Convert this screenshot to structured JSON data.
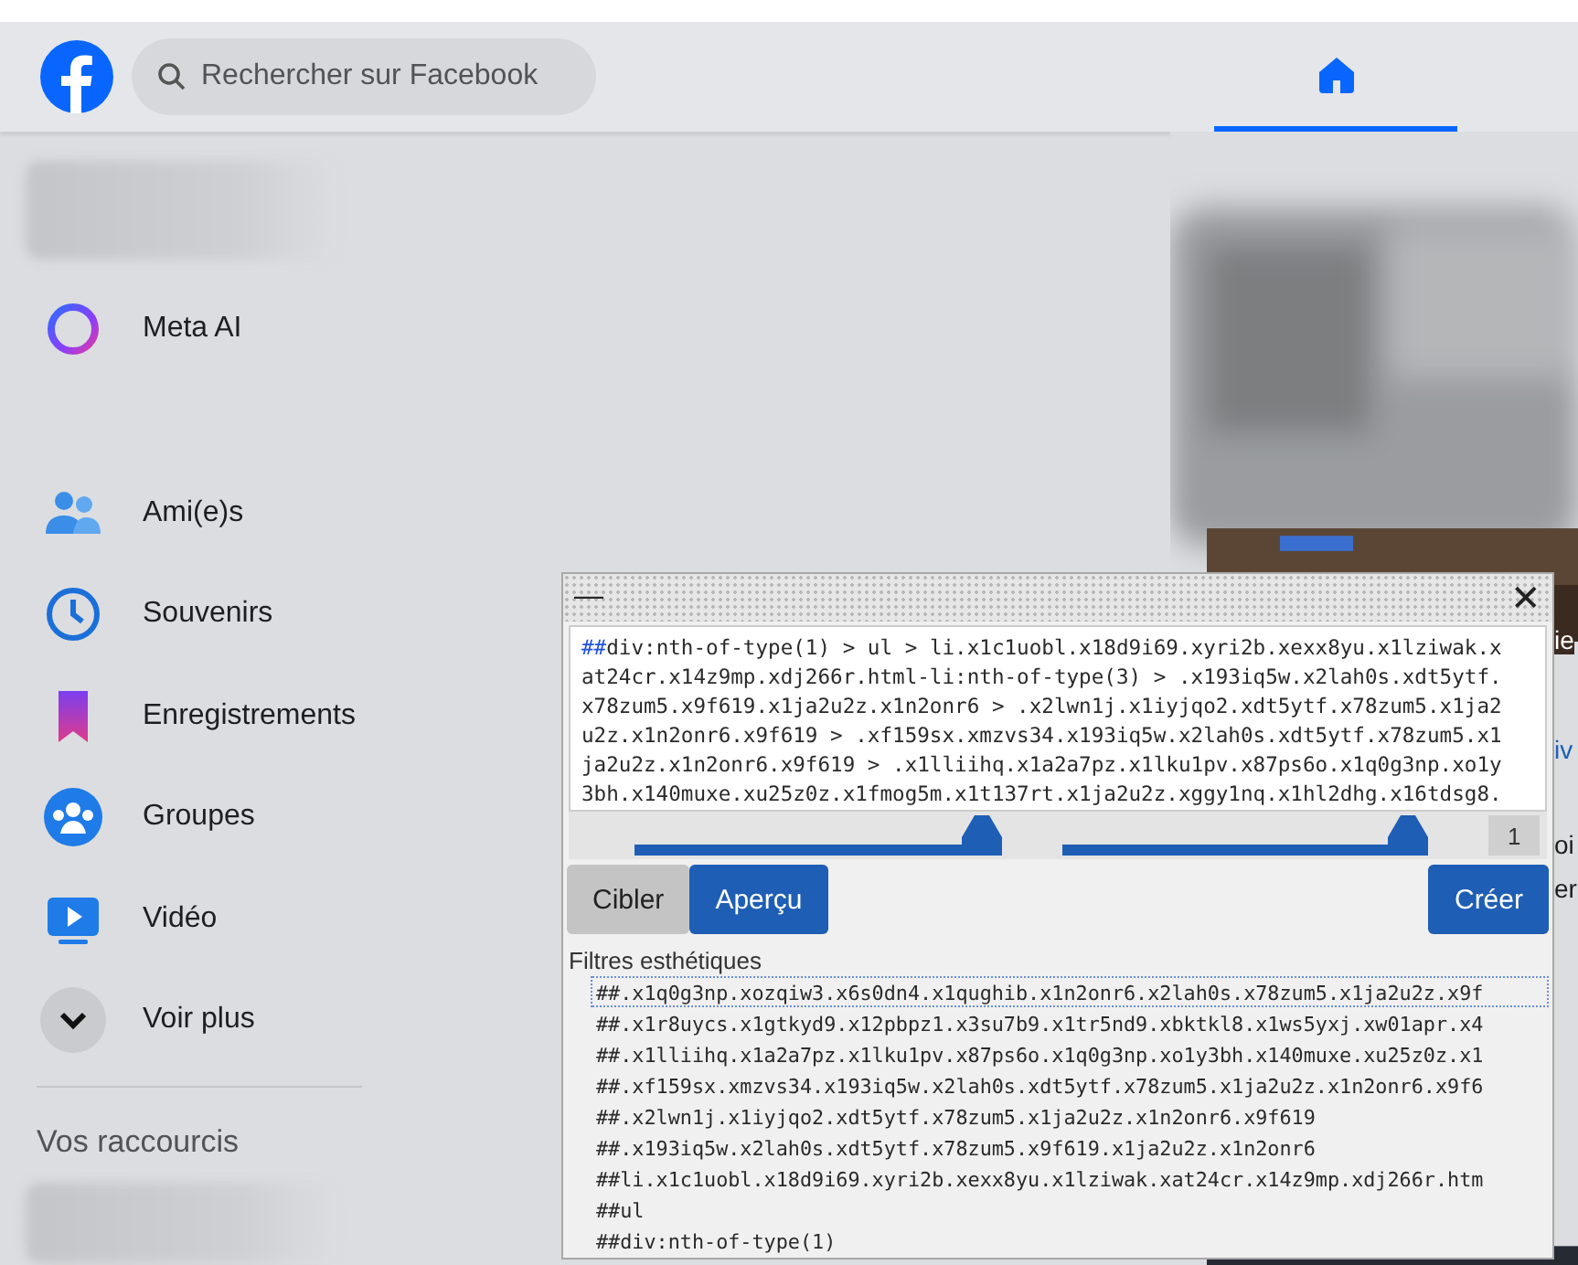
{
  "header": {
    "search": {
      "placeholder": "Rechercher sur Facebook"
    },
    "nav_tabs": [
      {
        "kind": "home",
        "selected": true
      }
    ]
  },
  "sidebar": {
    "items": [
      {
        "kind": "meta-ai",
        "label": "Meta AI"
      },
      {
        "kind": "friends",
        "label": "Ami(e)s"
      },
      {
        "kind": "memories",
        "label": "Souvenirs"
      },
      {
        "kind": "saved",
        "label": "Enregistrements"
      },
      {
        "kind": "groups",
        "label": "Groupes"
      },
      {
        "kind": "video",
        "label": "Vidéo"
      },
      {
        "kind": "more",
        "label": "Voir plus"
      }
    ],
    "shortcuts_title": "Vos raccourcis"
  },
  "feed": {
    "fragments": [
      "ie",
      "iv",
      "oi",
      "er"
    ]
  },
  "filter_dialog": {
    "minimize": "—",
    "close": "✕",
    "selector_lines": [
      "##div:nth-of-type(1) > ul > li.x1c1uobl.x18d9i69.xyri2b.xexx8yu.x1lziwak.x",
      "at24cr.x14z9mp.xdj266r.html-li:nth-of-type(3) > .x193iq5w.x2lah0s.xdt5ytf.",
      "x78zum5.x9f619.x1ja2u2z.x1n2onr6 > .x2lwn1j.x1iyjqo2.xdt5ytf.x78zum5.x1ja2",
      "u2z.x1n2onr6.x9f619 > .xf159sx.xmzvs34.x193iq5w.x2lah0s.xdt5ytf.x78zum5.x1",
      "ja2u2z.x1n2onr6.x9f619 > .x1lliihq.x1a2a7pz.x1lku1pv.x87ps6o.x1q0g3np.xo1y",
      "3bh.x140muxe.xu25z0z.x1fmog5m.x1t137rt.x1ja2u2z.xggy1nq.x1hl2dhg.x16tdsg8."
    ],
    "sliders": [
      {
        "level": 0.96
      },
      {
        "level": 0.96
      }
    ],
    "count": "1",
    "buttons": [
      {
        "label": "Cibler",
        "kind": "plain"
      },
      {
        "label": "Aperçu",
        "kind": "primary"
      },
      {
        "label": "Créer",
        "kind": "primary"
      }
    ],
    "filters_title": "Filtres esthétiques",
    "filters": [
      {
        "text": "##.x1q0g3np.xozqiw3.x6s0dn4.x1qughib.x1n2onr6.x2lah0s.x78zum5.x1ja2u2z.x9f",
        "selected": true
      },
      {
        "text": "##.x1r8uycs.x1gtkyd9.x12pbpz1.x3su7b9.x1tr5nd9.xbktkl8.x1ws5yxj.xw01apr.x4",
        "selected": false
      },
      {
        "text": "##.x1lliihq.x1a2a7pz.x1lku1pv.x87ps6o.x1q0g3np.xo1y3bh.x140muxe.xu25z0z.x1",
        "selected": false
      },
      {
        "text": "##.xf159sx.xmzvs34.x193iq5w.x2lah0s.xdt5ytf.x78zum5.x1ja2u2z.x1n2onr6.x9f6",
        "selected": false
      },
      {
        "text": "##.x2lwn1j.x1iyjqo2.xdt5ytf.x78zum5.x1ja2u2z.x1n2onr6.x9f619",
        "selected": false
      },
      {
        "text": "##.x193iq5w.x2lah0s.xdt5ytf.x78zum5.x9f619.x1ja2u2z.x1n2onr6",
        "selected": false
      },
      {
        "text": "##li.x1c1uobl.x18d9i69.xyri2b.xexx8yu.x1lziwak.xat24cr.x14z9mp.xdj266r.htm",
        "selected": false
      },
      {
        "text": "##ul",
        "selected": false
      },
      {
        "text": "##div:nth-of-type(1)",
        "selected": false
      }
    ]
  }
}
